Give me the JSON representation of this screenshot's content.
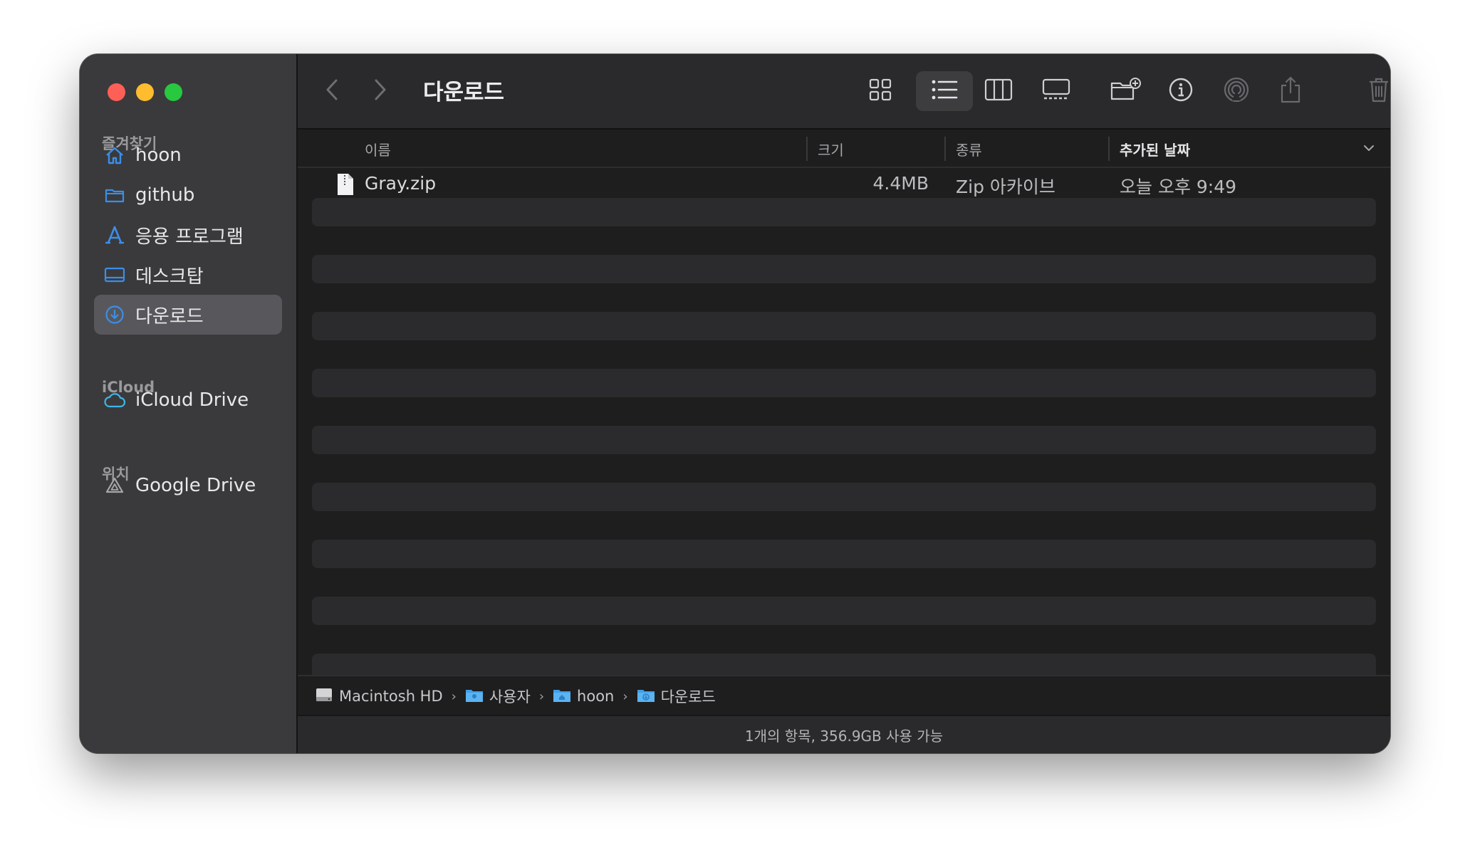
{
  "window": {
    "title": "다운로드"
  },
  "sidebar": {
    "sections": [
      {
        "title": "즐겨찾기",
        "items": [
          {
            "label": "hoon",
            "icon": "home-icon"
          },
          {
            "label": "github",
            "icon": "folder-icon"
          },
          {
            "label": "응용 프로그램",
            "icon": "applications-icon"
          },
          {
            "label": "데스크탑",
            "icon": "desktop-icon"
          },
          {
            "label": "다운로드",
            "icon": "download-icon",
            "selected": true
          }
        ]
      },
      {
        "title": "iCloud",
        "items": [
          {
            "label": "iCloud Drive",
            "icon": "cloud-icon"
          }
        ]
      },
      {
        "title": "위치",
        "items": [
          {
            "label": "Google Drive",
            "icon": "google-drive-icon"
          }
        ]
      }
    ]
  },
  "toolbar": {
    "icons": [
      "back-icon",
      "forward-icon",
      "icon-view-icon",
      "list-view-icon",
      "column-view-icon",
      "gallery-view-icon",
      "new-folder-icon",
      "info-icon",
      "airdrop-icon",
      "share-icon",
      "trash-icon",
      "search-icon"
    ],
    "active_view": "list"
  },
  "columns": {
    "name": "이름",
    "size": "크기",
    "kind": "종류",
    "date_added": "추가된 날짜"
  },
  "files": [
    {
      "name": "Gray.zip",
      "size": "4.4MB",
      "kind": "Zip 아카이브",
      "date_added": "오늘 오후 9:49"
    }
  ],
  "pathbar": [
    {
      "label": "Macintosh HD",
      "icon": "hard-drive-icon"
    },
    {
      "label": "사용자",
      "icon": "folder-icon"
    },
    {
      "label": "hoon",
      "icon": "home-folder-icon"
    },
    {
      "label": "다운로드",
      "icon": "downloads-folder-icon"
    }
  ],
  "status": "1개의 항목, 356.9GB 사용 가능",
  "colors": {
    "accent": "#3b8eea",
    "sidebar_bg": "#3a3a3c",
    "content_bg": "#1e1e1e"
  }
}
